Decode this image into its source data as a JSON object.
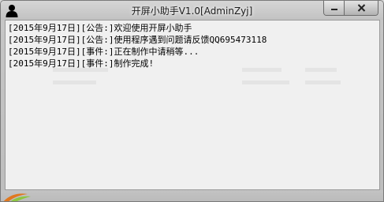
{
  "window": {
    "title": "开屏小助手V1.0[AdminZyj]",
    "minimize_glyph": "—",
    "close_glyph": "✕",
    "icon": "user-silhouette-icon"
  },
  "log": {
    "lines": [
      "[2015年9月17日][公告:]欢迎使用开屏小助手",
      "[2015年9月17日][公告:]使用程序遇到问题请反馈QQ695473118",
      "[2015年9月17日][事件:]正在制作中请稍等...",
      "[2015年9月17日][事件:]制作完成!"
    ]
  }
}
